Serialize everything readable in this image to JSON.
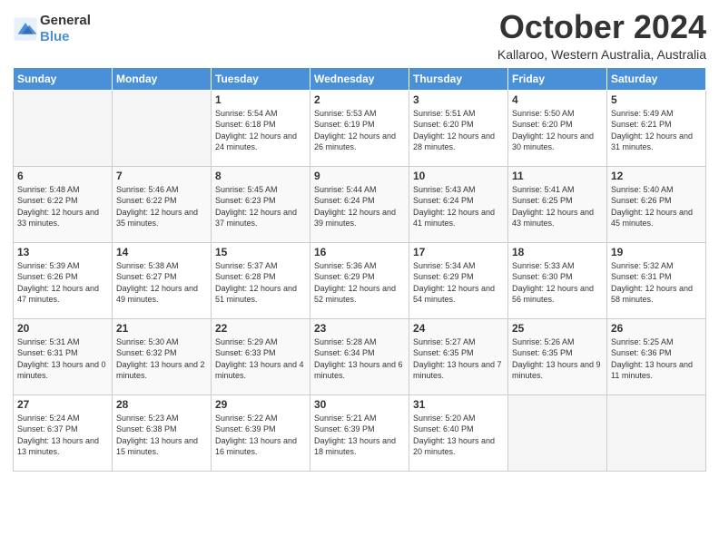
{
  "logo": {
    "line1": "General",
    "line2": "Blue"
  },
  "title": "October 2024",
  "location": "Kallaroo, Western Australia, Australia",
  "days_of_week": [
    "Sunday",
    "Monday",
    "Tuesday",
    "Wednesday",
    "Thursday",
    "Friday",
    "Saturday"
  ],
  "weeks": [
    [
      {
        "day": "",
        "empty": true
      },
      {
        "day": "",
        "empty": true
      },
      {
        "day": "1",
        "info": "Sunrise: 5:54 AM\nSunset: 6:18 PM\nDaylight: 12 hours and 24 minutes."
      },
      {
        "day": "2",
        "info": "Sunrise: 5:53 AM\nSunset: 6:19 PM\nDaylight: 12 hours and 26 minutes."
      },
      {
        "day": "3",
        "info": "Sunrise: 5:51 AM\nSunset: 6:20 PM\nDaylight: 12 hours and 28 minutes."
      },
      {
        "day": "4",
        "info": "Sunrise: 5:50 AM\nSunset: 6:20 PM\nDaylight: 12 hours and 30 minutes."
      },
      {
        "day": "5",
        "info": "Sunrise: 5:49 AM\nSunset: 6:21 PM\nDaylight: 12 hours and 31 minutes."
      }
    ],
    [
      {
        "day": "6",
        "info": "Sunrise: 5:48 AM\nSunset: 6:22 PM\nDaylight: 12 hours and 33 minutes."
      },
      {
        "day": "7",
        "info": "Sunrise: 5:46 AM\nSunset: 6:22 PM\nDaylight: 12 hours and 35 minutes."
      },
      {
        "day": "8",
        "info": "Sunrise: 5:45 AM\nSunset: 6:23 PM\nDaylight: 12 hours and 37 minutes."
      },
      {
        "day": "9",
        "info": "Sunrise: 5:44 AM\nSunset: 6:24 PM\nDaylight: 12 hours and 39 minutes."
      },
      {
        "day": "10",
        "info": "Sunrise: 5:43 AM\nSunset: 6:24 PM\nDaylight: 12 hours and 41 minutes."
      },
      {
        "day": "11",
        "info": "Sunrise: 5:41 AM\nSunset: 6:25 PM\nDaylight: 12 hours and 43 minutes."
      },
      {
        "day": "12",
        "info": "Sunrise: 5:40 AM\nSunset: 6:26 PM\nDaylight: 12 hours and 45 minutes."
      }
    ],
    [
      {
        "day": "13",
        "info": "Sunrise: 5:39 AM\nSunset: 6:26 PM\nDaylight: 12 hours and 47 minutes."
      },
      {
        "day": "14",
        "info": "Sunrise: 5:38 AM\nSunset: 6:27 PM\nDaylight: 12 hours and 49 minutes."
      },
      {
        "day": "15",
        "info": "Sunrise: 5:37 AM\nSunset: 6:28 PM\nDaylight: 12 hours and 51 minutes."
      },
      {
        "day": "16",
        "info": "Sunrise: 5:36 AM\nSunset: 6:29 PM\nDaylight: 12 hours and 52 minutes."
      },
      {
        "day": "17",
        "info": "Sunrise: 5:34 AM\nSunset: 6:29 PM\nDaylight: 12 hours and 54 minutes."
      },
      {
        "day": "18",
        "info": "Sunrise: 5:33 AM\nSunset: 6:30 PM\nDaylight: 12 hours and 56 minutes."
      },
      {
        "day": "19",
        "info": "Sunrise: 5:32 AM\nSunset: 6:31 PM\nDaylight: 12 hours and 58 minutes."
      }
    ],
    [
      {
        "day": "20",
        "info": "Sunrise: 5:31 AM\nSunset: 6:31 PM\nDaylight: 13 hours and 0 minutes."
      },
      {
        "day": "21",
        "info": "Sunrise: 5:30 AM\nSunset: 6:32 PM\nDaylight: 13 hours and 2 minutes."
      },
      {
        "day": "22",
        "info": "Sunrise: 5:29 AM\nSunset: 6:33 PM\nDaylight: 13 hours and 4 minutes."
      },
      {
        "day": "23",
        "info": "Sunrise: 5:28 AM\nSunset: 6:34 PM\nDaylight: 13 hours and 6 minutes."
      },
      {
        "day": "24",
        "info": "Sunrise: 5:27 AM\nSunset: 6:35 PM\nDaylight: 13 hours and 7 minutes."
      },
      {
        "day": "25",
        "info": "Sunrise: 5:26 AM\nSunset: 6:35 PM\nDaylight: 13 hours and 9 minutes."
      },
      {
        "day": "26",
        "info": "Sunrise: 5:25 AM\nSunset: 6:36 PM\nDaylight: 13 hours and 11 minutes."
      }
    ],
    [
      {
        "day": "27",
        "info": "Sunrise: 5:24 AM\nSunset: 6:37 PM\nDaylight: 13 hours and 13 minutes."
      },
      {
        "day": "28",
        "info": "Sunrise: 5:23 AM\nSunset: 6:38 PM\nDaylight: 13 hours and 15 minutes."
      },
      {
        "day": "29",
        "info": "Sunrise: 5:22 AM\nSunset: 6:39 PM\nDaylight: 13 hours and 16 minutes."
      },
      {
        "day": "30",
        "info": "Sunrise: 5:21 AM\nSunset: 6:39 PM\nDaylight: 13 hours and 18 minutes."
      },
      {
        "day": "31",
        "info": "Sunrise: 5:20 AM\nSunset: 6:40 PM\nDaylight: 13 hours and 20 minutes."
      },
      {
        "day": "",
        "empty": true
      },
      {
        "day": "",
        "empty": true
      }
    ]
  ]
}
